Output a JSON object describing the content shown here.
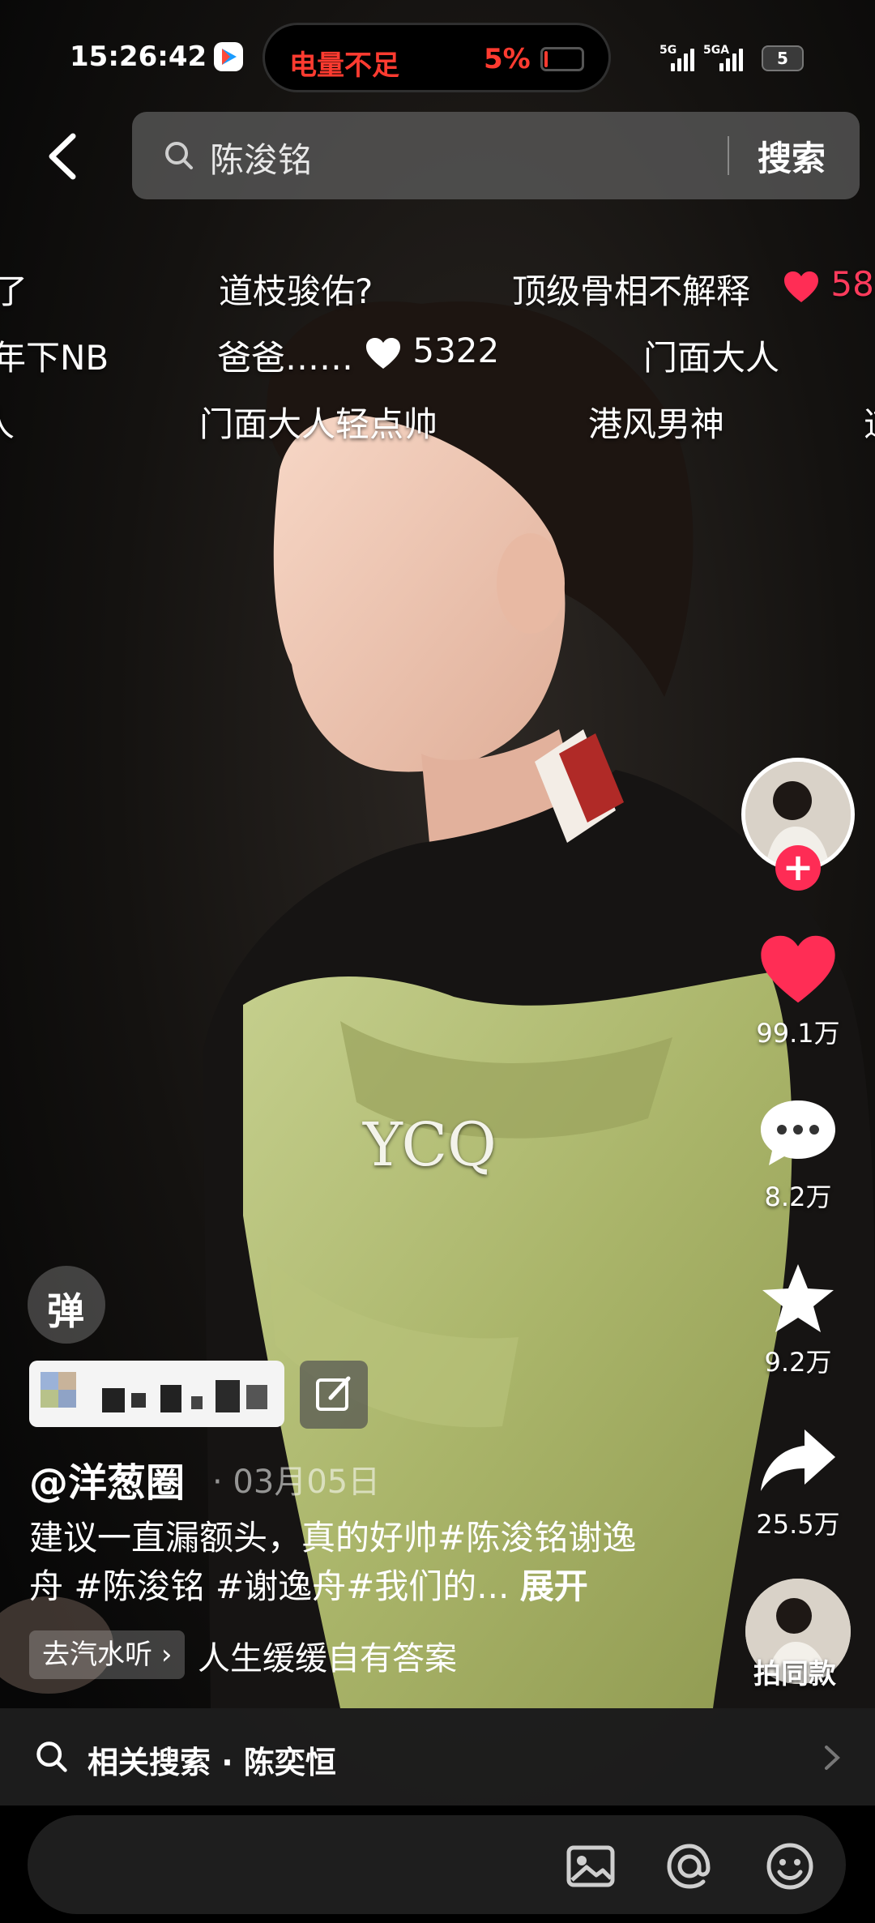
{
  "status_bar": {
    "time": "15:26:42",
    "battery_warning": "电量不足",
    "battery_percent": "5%",
    "network_1": "5G",
    "network_2": "5GA",
    "phone_battery": "5"
  },
  "search": {
    "query": "陈浚铭",
    "button": "搜索"
  },
  "danmaku": [
    {
      "text": "了"
    },
    {
      "text": "道枝骏佑?"
    },
    {
      "text": "顶级骨相不解释"
    },
    {
      "text": "58",
      "type": "likes"
    },
    {
      "text": "年下NB"
    },
    {
      "text": "爸爸……"
    },
    {
      "text": "5322"
    },
    {
      "text": "门面大人"
    },
    {
      "text": "人"
    },
    {
      "text": "门面大人轻点帅"
    },
    {
      "text": "港风男神"
    },
    {
      "text": "道"
    }
  ],
  "watermark": "YCQ",
  "rail": {
    "likes": "99.1万",
    "comments": "8.2万",
    "favorites": "9.2万",
    "shares": "25.5万",
    "same_style": "拍同款"
  },
  "post": {
    "danmu_toggle": "弹",
    "author": "@洋葱圈",
    "date": "· 03月05日",
    "caption": "建议一直漏额头，真的好帅#陈浚铭谢逸舟 #陈浚铭 #谢逸舟#我们的...",
    "expand": "展开",
    "music_tag": "去汽水听",
    "music_title": "人生缓缓自有答案"
  },
  "related_search": {
    "label": "相关搜索 · 陈奕恒"
  },
  "colors": {
    "accent_red": "#fe2c55",
    "heart": "#ff2d55",
    "warning": "#ff3b30"
  },
  "icons": [
    "back-icon",
    "search-icon",
    "heart-icon",
    "comment-icon",
    "star-icon",
    "share-icon",
    "image-icon",
    "at-icon",
    "emoji-icon",
    "chevron-right-icon"
  ]
}
